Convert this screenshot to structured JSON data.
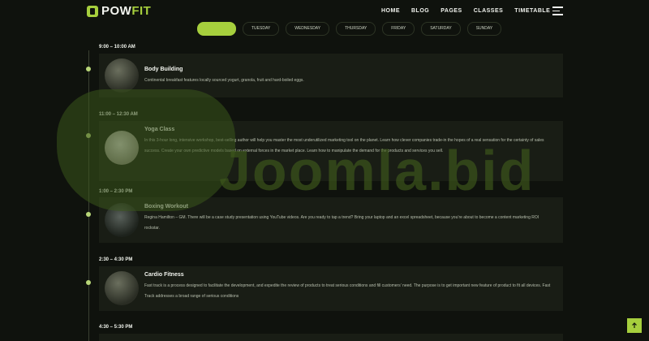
{
  "brand": {
    "name_main": "POW",
    "name_accent": "FIT"
  },
  "nav": [
    {
      "label": "HOME"
    },
    {
      "label": "BLOG"
    },
    {
      "label": "PAGES"
    },
    {
      "label": "CLASSES"
    },
    {
      "label": "TIMETABLE"
    }
  ],
  "days": [
    {
      "label": ""
    },
    {
      "label": "TUESDAY"
    },
    {
      "label": "WEDNESDAY"
    },
    {
      "label": "THURSDAY"
    },
    {
      "label": "FRIDAY"
    },
    {
      "label": "SATURDAY"
    },
    {
      "label": "SUNDAY"
    }
  ],
  "schedule": [
    {
      "time": "9:00 – 10:00 AM",
      "title": "Body Building",
      "desc": "Continental breakfast features locally sourced yogurt, granola, fruit and hard-boiled eggs."
    },
    {
      "time": "11:00 – 12:30 AM",
      "title": "Yoga Class",
      "desc": "In this 3-hour long, intensive workshop, best-selling author will help you master the most underutilized marketing tool on the planet. Learn how clever companies trade-in the hopes of a real sensation for the certainty of sales success. Create your own predictive models based on external forces in the market place. Learn how to manipulate the demand for the products and services you sell."
    },
    {
      "time": "1:00 – 2:30 PM",
      "title": "Boxing Workout",
      "desc": "Regina Hamilton – GM. There will be a case study presentation using YouTube videos. Are you ready to tap a trend? Bring your laptop and an excel spreadsheet, because you’re about to become a content marketing ROI rockstar."
    },
    {
      "time": "2:30 – 4:30 PM",
      "title": "Cardio Fitness",
      "desc": "Fast track is a process designed to facilitate the development, and expedite the review of products to treat serious conditions and fill customers’ need. The purpose is to get important new feature of product to fit all devices. Fast Track addresses a broad range of serious conditions"
    },
    {
      "time": "4:30 – 5:30 PM"
    }
  ],
  "watermark": "Joomla.bid",
  "colors": {
    "accent": "#a6cf3d",
    "background": "#0f120d",
    "card": "#191d15"
  }
}
